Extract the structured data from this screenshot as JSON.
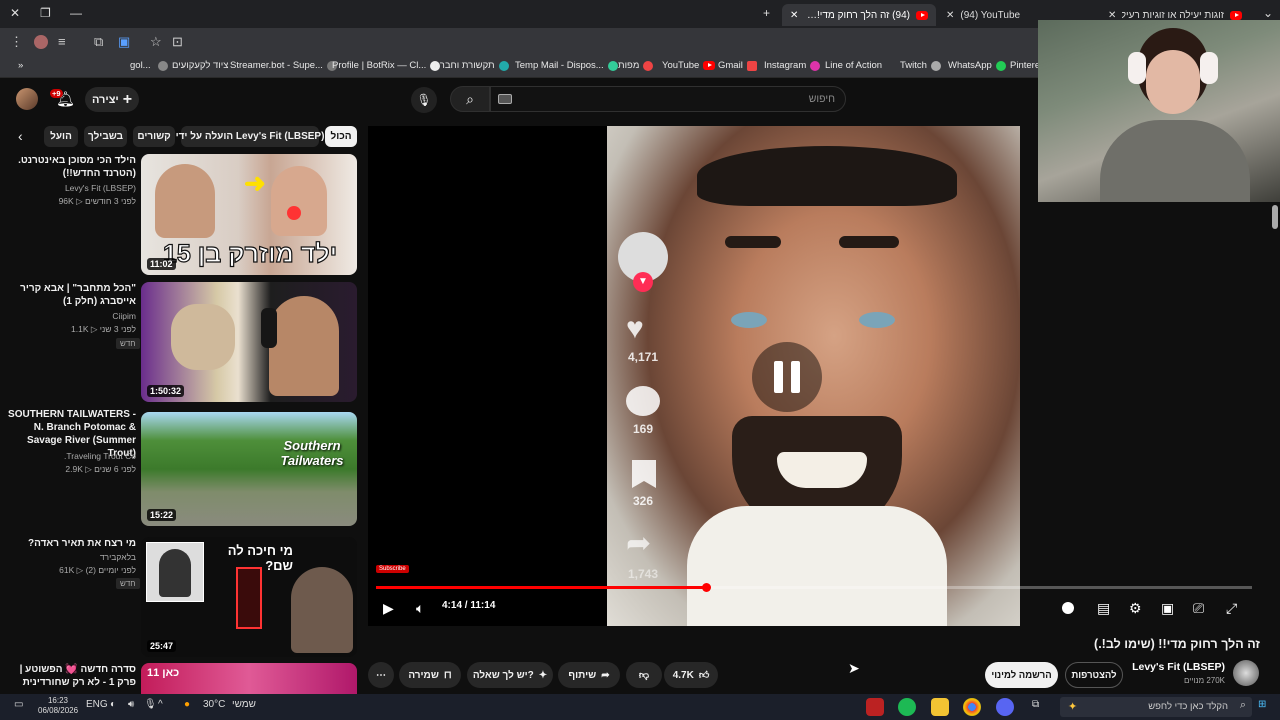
{
  "browser": {
    "tabs": [
      {
        "title": "(94) זה הלך רחוק מדי!! (שי…",
        "active": true
      },
      {
        "title": "(94) YouTube",
        "active": false
      },
      {
        "title": "זוגות יעילה או זוגיות רעילה?",
        "active": false
      }
    ],
    "address": "you",
    "bookmarks": [
      "gol...",
      "ציוד לקעקועים",
      "Streamer.bot - Supe...",
      "Profile | BotRix — Cl...",
      "תקשורת וחברה",
      "Temp Mail - Dispos...",
      "מפות",
      "YouTube",
      "Gmail",
      "Instagram",
      "Line of Action",
      "Twitch",
      "WhatsApp",
      "Pinteres"
    ]
  },
  "header": {
    "search_placeholder": "חיפוש",
    "create_label": "יצירה",
    "notif_badge": "+9"
  },
  "chips": [
    "הכול",
    "הועלה על ידי Levy's Fit (LBSEP)",
    "קשורים",
    "בשבילך",
    "הועל"
  ],
  "sidebar_videos": [
    {
      "title": "הילד הכי מסוכן באינטרנט. (הטרנד החדש!!)",
      "channel": "Levy's Fit (LBSEP)",
      "views": "96K",
      "age": "לפני 3 חודשים",
      "duration": "11:02",
      "thumb_text": "ילד מוזרק בן 15",
      "is_new": false
    },
    {
      "title": "\"הכל מתחבר\" | אבא קריר אייסברג (חלק 1)",
      "channel": "Ciipim",
      "views": "1.1K",
      "age": "לפני 3 שני",
      "duration": "1:50:32",
      "thumb_text": "",
      "is_new": true
    },
    {
      "title": "SOUTHERN TAILWATERS - N. Branch Potomac & Savage River (Summer Trout)",
      "channel": "Traveling Trout Co.",
      "views": "2.9K",
      "age": "לפני 6 שנים",
      "duration": "15:22",
      "thumb_text": "Southern Tailwaters",
      "is_new": false
    },
    {
      "title": "מי רצח את תאיר ראדה?",
      "channel": "בלאקבירד",
      "views": "61K",
      "age": "לפני יומיים (2)",
      "duration": "25:47",
      "thumb_text": "מי חיכה לה שם?",
      "is_new": true
    },
    {
      "title": "סדרה חדשה 💓 הפשוטע | פרק 1 - לא רק שחורדינית",
      "channel": "",
      "views": "",
      "age": "",
      "duration": "",
      "thumb_text": "כאן 11",
      "is_new": false
    }
  ],
  "player": {
    "current_time": "4:14",
    "total_time": "11:14",
    "progress": 0.377,
    "subscribe_tag": "Subscribe",
    "side_stats": {
      "likes": "4,171",
      "comments": "169",
      "saves": "326",
      "shares": "1,743"
    }
  },
  "video": {
    "title": "זה הלך רחוק מדי!! (שימו לב!.)",
    "channel": "Levy's Fit (LBSEP)",
    "subscribers": "270K מנויים",
    "join_label": "להצטרפות",
    "subscribed_label": "הרשמה למינוי",
    "like_count": "4.7K",
    "share_label": "שיתוף",
    "ask_label": "יש לך שאלה?",
    "save_label": "שמירה"
  },
  "taskbar": {
    "search_placeholder": "הקלד כאן כדי לחפש",
    "weather": "30°C",
    "weather_label": "שמשי",
    "time": "16:23",
    "date": "06/08/2026",
    "lang": "ENG"
  },
  "colors": {
    "accent_red": "#ff0000",
    "bg": "#0f0f0f",
    "chip_bg": "#272727"
  }
}
